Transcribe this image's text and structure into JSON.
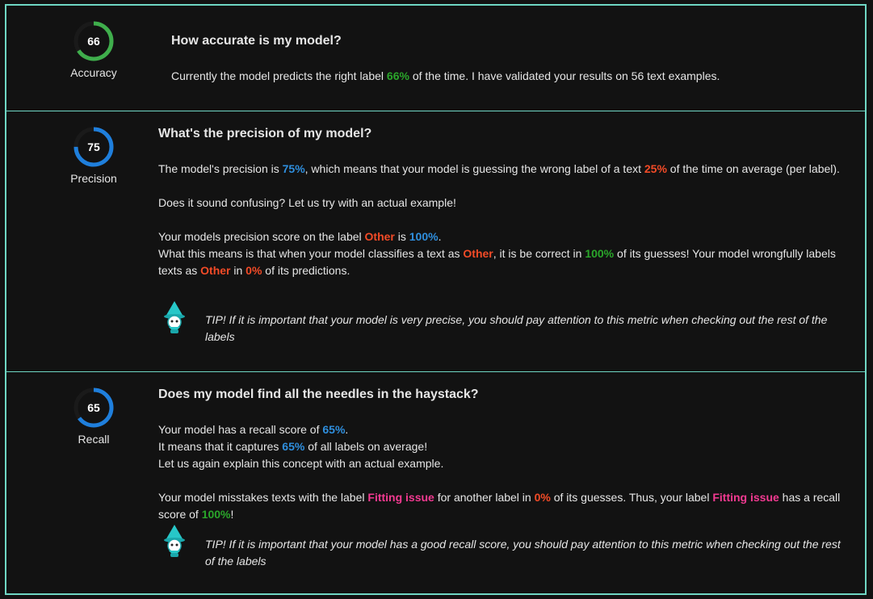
{
  "accuracy": {
    "score": "66",
    "score_fraction": 0.66,
    "ring_color": "#3fae4c",
    "label": "Accuracy",
    "heading": "How accurate is my model?",
    "line1": {
      "a": "Currently the model predicts the right label ",
      "pct": "66%",
      "b": " of the time. I have validated your results on 56 text examples."
    }
  },
  "precision": {
    "score": "75",
    "score_fraction": 0.75,
    "ring_color": "#1f7fdc",
    "label": "Precision",
    "heading": "What's the precision of my model?",
    "line1": {
      "a": "The model's precision is ",
      "pct": "75%",
      "b": ", which means that your model is guessing the wrong label of a text ",
      "wrong_pct": "25%",
      "c": " of the time on average (per label)."
    },
    "line2": "Does it sound confusing? Let us try with an actual example!",
    "line3": {
      "a": "Your models precision score on the label ",
      "label": "Other",
      "b": " is ",
      "pct": "100%",
      "c": "."
    },
    "line4": {
      "a": "What this means is that when your model classifies a text as ",
      "label": "Other",
      "b": ", it is be correct in ",
      "pct": "100%",
      "c": " of its guesses! Your model wrongfully labels"
    },
    "line5": {
      "a": "texts as ",
      "label": "Other",
      "b": " in ",
      "pct": "0%",
      "c": " of its predictions."
    },
    "tip_line1": "TIP! If it is important that your model is very precise, you should pay attention to this metric when checking out the rest of the",
    "tip_line2": "labels"
  },
  "recall": {
    "score": "65",
    "score_fraction": 0.65,
    "ring_color": "#1f7fdc",
    "label": "Recall",
    "heading": "Does my model find all the needles in the haystack?",
    "line1": {
      "a": "Your model has a recall score of ",
      "pct": "65%",
      "b": "."
    },
    "line2": {
      "a": "It means that it captures ",
      "pct": "65%",
      "b": " of all labels on average!"
    },
    "line3": "Let us again explain this concept with an actual example.",
    "line4": {
      "a": "Your model misstakes texts with the label ",
      "label": "Fitting issue",
      "b": " for another label in ",
      "pct": "0%",
      "c": " of its guesses. Thus, your label ",
      "label2": "Fitting issue",
      "d": " has a recall"
    },
    "line5": {
      "a": "score of ",
      "pct": "100%",
      "b": "!"
    },
    "tip_line1": "TIP! If it is important that your model has a good recall score, you should pay attention to this metric when checking out the rest",
    "tip_line2": "of the labels"
  },
  "colors": {
    "border": "#6fd7c4",
    "background": "#121212",
    "good": "#2aa62a",
    "info": "#2f8fde",
    "bad": "#f34b27",
    "label_highlight": "#f23a91"
  },
  "icons": {
    "mascot": "wizard-mascot-icon"
  }
}
